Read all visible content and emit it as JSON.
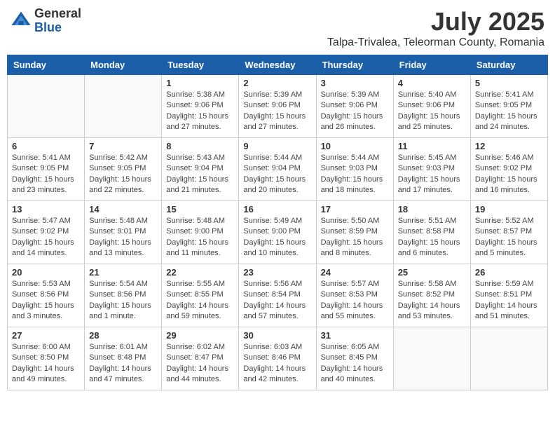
{
  "header": {
    "logo_general": "General",
    "logo_blue": "Blue",
    "title": "July 2025",
    "location": "Talpa-Trivalea, Teleorman County, Romania"
  },
  "days_of_week": [
    "Sunday",
    "Monday",
    "Tuesday",
    "Wednesday",
    "Thursday",
    "Friday",
    "Saturday"
  ],
  "weeks": [
    [
      {
        "day": "",
        "info": ""
      },
      {
        "day": "",
        "info": ""
      },
      {
        "day": "1",
        "info": "Sunrise: 5:38 AM\nSunset: 9:06 PM\nDaylight: 15 hours and 27 minutes."
      },
      {
        "day": "2",
        "info": "Sunrise: 5:39 AM\nSunset: 9:06 PM\nDaylight: 15 hours and 27 minutes."
      },
      {
        "day": "3",
        "info": "Sunrise: 5:39 AM\nSunset: 9:06 PM\nDaylight: 15 hours and 26 minutes."
      },
      {
        "day": "4",
        "info": "Sunrise: 5:40 AM\nSunset: 9:06 PM\nDaylight: 15 hours and 25 minutes."
      },
      {
        "day": "5",
        "info": "Sunrise: 5:41 AM\nSunset: 9:05 PM\nDaylight: 15 hours and 24 minutes."
      }
    ],
    [
      {
        "day": "6",
        "info": "Sunrise: 5:41 AM\nSunset: 9:05 PM\nDaylight: 15 hours and 23 minutes."
      },
      {
        "day": "7",
        "info": "Sunrise: 5:42 AM\nSunset: 9:05 PM\nDaylight: 15 hours and 22 minutes."
      },
      {
        "day": "8",
        "info": "Sunrise: 5:43 AM\nSunset: 9:04 PM\nDaylight: 15 hours and 21 minutes."
      },
      {
        "day": "9",
        "info": "Sunrise: 5:44 AM\nSunset: 9:04 PM\nDaylight: 15 hours and 20 minutes."
      },
      {
        "day": "10",
        "info": "Sunrise: 5:44 AM\nSunset: 9:03 PM\nDaylight: 15 hours and 18 minutes."
      },
      {
        "day": "11",
        "info": "Sunrise: 5:45 AM\nSunset: 9:03 PM\nDaylight: 15 hours and 17 minutes."
      },
      {
        "day": "12",
        "info": "Sunrise: 5:46 AM\nSunset: 9:02 PM\nDaylight: 15 hours and 16 minutes."
      }
    ],
    [
      {
        "day": "13",
        "info": "Sunrise: 5:47 AM\nSunset: 9:02 PM\nDaylight: 15 hours and 14 minutes."
      },
      {
        "day": "14",
        "info": "Sunrise: 5:48 AM\nSunset: 9:01 PM\nDaylight: 15 hours and 13 minutes."
      },
      {
        "day": "15",
        "info": "Sunrise: 5:48 AM\nSunset: 9:00 PM\nDaylight: 15 hours and 11 minutes."
      },
      {
        "day": "16",
        "info": "Sunrise: 5:49 AM\nSunset: 9:00 PM\nDaylight: 15 hours and 10 minutes."
      },
      {
        "day": "17",
        "info": "Sunrise: 5:50 AM\nSunset: 8:59 PM\nDaylight: 15 hours and 8 minutes."
      },
      {
        "day": "18",
        "info": "Sunrise: 5:51 AM\nSunset: 8:58 PM\nDaylight: 15 hours and 6 minutes."
      },
      {
        "day": "19",
        "info": "Sunrise: 5:52 AM\nSunset: 8:57 PM\nDaylight: 15 hours and 5 minutes."
      }
    ],
    [
      {
        "day": "20",
        "info": "Sunrise: 5:53 AM\nSunset: 8:56 PM\nDaylight: 15 hours and 3 minutes."
      },
      {
        "day": "21",
        "info": "Sunrise: 5:54 AM\nSunset: 8:56 PM\nDaylight: 15 hours and 1 minute."
      },
      {
        "day": "22",
        "info": "Sunrise: 5:55 AM\nSunset: 8:55 PM\nDaylight: 14 hours and 59 minutes."
      },
      {
        "day": "23",
        "info": "Sunrise: 5:56 AM\nSunset: 8:54 PM\nDaylight: 14 hours and 57 minutes."
      },
      {
        "day": "24",
        "info": "Sunrise: 5:57 AM\nSunset: 8:53 PM\nDaylight: 14 hours and 55 minutes."
      },
      {
        "day": "25",
        "info": "Sunrise: 5:58 AM\nSunset: 8:52 PM\nDaylight: 14 hours and 53 minutes."
      },
      {
        "day": "26",
        "info": "Sunrise: 5:59 AM\nSunset: 8:51 PM\nDaylight: 14 hours and 51 minutes."
      }
    ],
    [
      {
        "day": "27",
        "info": "Sunrise: 6:00 AM\nSunset: 8:50 PM\nDaylight: 14 hours and 49 minutes."
      },
      {
        "day": "28",
        "info": "Sunrise: 6:01 AM\nSunset: 8:48 PM\nDaylight: 14 hours and 47 minutes."
      },
      {
        "day": "29",
        "info": "Sunrise: 6:02 AM\nSunset: 8:47 PM\nDaylight: 14 hours and 44 minutes."
      },
      {
        "day": "30",
        "info": "Sunrise: 6:03 AM\nSunset: 8:46 PM\nDaylight: 14 hours and 42 minutes."
      },
      {
        "day": "31",
        "info": "Sunrise: 6:05 AM\nSunset: 8:45 PM\nDaylight: 14 hours and 40 minutes."
      },
      {
        "day": "",
        "info": ""
      },
      {
        "day": "",
        "info": ""
      }
    ]
  ]
}
